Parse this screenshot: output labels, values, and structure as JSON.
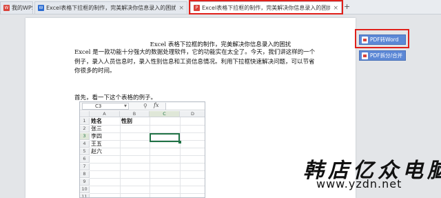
{
  "tabs": [
    {
      "label": "我的WPS",
      "icon": "wps-logo-icon",
      "active": false
    },
    {
      "label": "Excel表格下拉框的制作，完美解决你信息录入的困扰.docx",
      "icon": "word-doc-icon",
      "active": false
    },
    {
      "label": "Excel表格下拉框的制作，完美解决你信息录入的困扰.pdf",
      "icon": "pdf-icon",
      "active": true
    }
  ],
  "new_tab_label": "+",
  "close_glyph": "×",
  "document": {
    "title": "Excel 表格下拉框的制作，完美解决你信息录入的困扰",
    "paragraph1": "Excel 是一款功能十分强大的数据处理软件，它的功能实在太全了。今天，我们讲这样的一个例子，录入人员信息时，录入性别信息和工资信息情况。利用下拉框快速解决问题，可以节省你很多的时间。",
    "paragraph2": "首先，看一下这个表格的例子。"
  },
  "spreadsheet": {
    "name_box": "C3",
    "fx_label": "fx",
    "columns": [
      "A",
      "B",
      "C",
      "D"
    ],
    "rows": [
      "1",
      "2",
      "3",
      "4",
      "5",
      "6",
      "7",
      "8",
      "9",
      "10",
      "11"
    ],
    "cells": {
      "A1": "姓名",
      "B1": "性别",
      "A2": "张三",
      "A3": "李四",
      "A4": "王五",
      "A5": "赵六"
    },
    "selected_cell": "C3"
  },
  "side_buttons": {
    "pdf_to_word": "PDF转Word",
    "pdf_split_merge": "PDF拆分/合并"
  },
  "watermark": {
    "line1": "韩店亿众电脑",
    "line2": "www.yzdn.net"
  },
  "colors": {
    "highlight_frame": "#e0201a",
    "button_blue": "#5c88d6",
    "selection_green": "#217346"
  }
}
